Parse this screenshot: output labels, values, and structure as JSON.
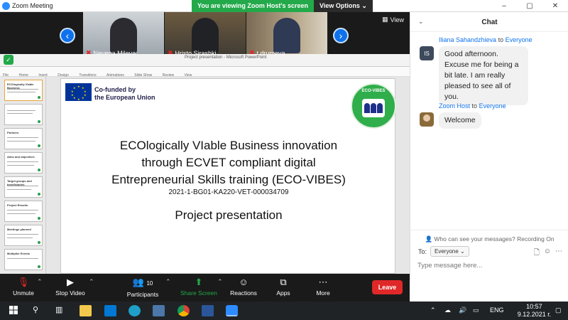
{
  "window": {
    "title": "Zoom Meeting",
    "controls": [
      "–",
      "▢",
      "✕"
    ]
  },
  "banner": {
    "viewing": "You are viewing Zoom Host's screen",
    "options": "View Options ⌄"
  },
  "gallery": {
    "view_label": "View",
    "participants": [
      {
        "name": "Nevena Mileva"
      },
      {
        "name": "Hristo Sirashki"
      },
      {
        "name": "t.drumeva"
      }
    ]
  },
  "powerpoint": {
    "window_title": "Project presentation - Microsoft PowerPoint",
    "ribbon_tabs": [
      "File",
      "Home",
      "Insert",
      "Design",
      "Transitions",
      "Animations",
      "Slide Show",
      "Review",
      "View"
    ],
    "thumbnails": [
      {
        "title": "ECOlogically Viable Business"
      },
      {
        "title": ""
      },
      {
        "title": "Partners"
      },
      {
        "title": "Aims and objectives"
      },
      {
        "title": "Target groups and beneficiaries"
      },
      {
        "title": "Project Results"
      },
      {
        "title": "Meetings planned"
      },
      {
        "title": "Multiplier Events"
      }
    ]
  },
  "slide": {
    "eu_line1": "Co-funded by",
    "eu_line2": "the European Union",
    "logo_text": "ECO-VIBES",
    "title_line1": "ECOlogically VIable Business innovation",
    "title_line2": "through ECVET compliant digital",
    "title_line3": "Entrepreneurial Skills training (ECO-VIBES)",
    "code": "2021-1-BG01-KA220-VET-000034709",
    "subtitle": "Project presentation"
  },
  "chat": {
    "title": "Chat",
    "messages": [
      {
        "from": "Iliana Sahandzhieva",
        "to_word": "to",
        "recipient": "Everyone",
        "initials": "IS",
        "text": "Good afternoon. Excuse me for being a bit late. I am really pleased to see all of you."
      },
      {
        "from": "Zoom Host",
        "to_word": "to",
        "recipient": "Everyone",
        "text": "Welcome"
      }
    ],
    "who_can_see": "Who can see your messages? Recording On",
    "to_label": "To:",
    "to_value": "Everyone",
    "placeholder": "Type message here..."
  },
  "toolbar": {
    "unmute": "Unmute",
    "stop_video": "Stop Video",
    "participants": "Participants",
    "participants_count": "10",
    "share_screen": "Share Screen",
    "reactions": "Reactions",
    "apps": "Apps",
    "more": "More",
    "leave": "Leave"
  },
  "taskbar": {
    "language": "ENG",
    "time": "10:57",
    "date": "9.12.2021 г."
  },
  "colors": {
    "zoom_blue": "#0e72ed",
    "share_green": "#23a94a",
    "leave_red": "#e02828",
    "logo_green": "#2fae4b"
  }
}
